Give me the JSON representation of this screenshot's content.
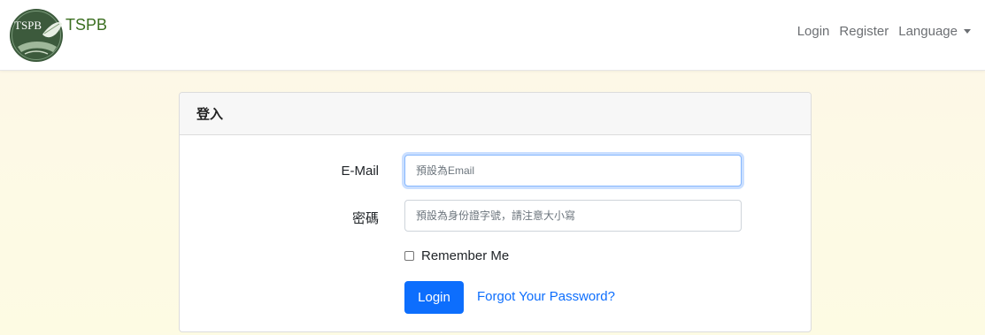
{
  "navbar": {
    "logo_text": "TSPB",
    "brand_name": "TSPB",
    "links": {
      "login": "Login",
      "register": "Register",
      "language": "Language"
    }
  },
  "login_card": {
    "title": "登入",
    "email": {
      "label": "E-Mail",
      "placeholder": "預設為Email",
      "value": ""
    },
    "password": {
      "label": "密碼",
      "placeholder": "預設為身份證字號，請注意大小寫",
      "value": ""
    },
    "remember_me": {
      "label": "Remember Me",
      "checked": false
    },
    "login_button": "Login",
    "forgot_password": "Forgot Your Password?"
  },
  "colors": {
    "brand_green": "#3a6e1f",
    "primary_blue": "#0d6efd",
    "nav_text": "#6c6f73",
    "background_cream": "#fdf9e6"
  }
}
